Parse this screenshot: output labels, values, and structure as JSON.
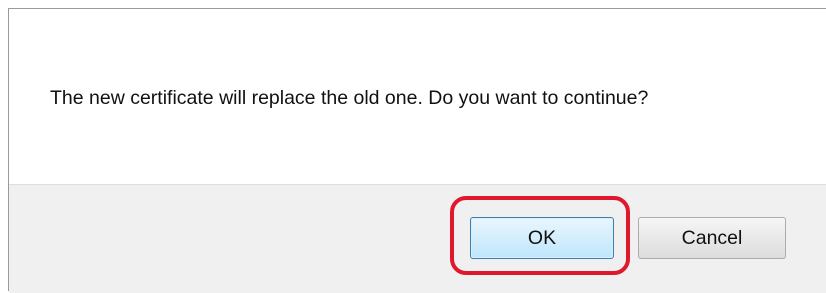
{
  "dialog": {
    "message": "The new certificate will replace the old one. Do you want to continue?",
    "buttons": {
      "ok_label": "OK",
      "cancel_label": "Cancel"
    },
    "highlight_color": "#e0182d",
    "default_button_accent": "#3c7fb1"
  }
}
